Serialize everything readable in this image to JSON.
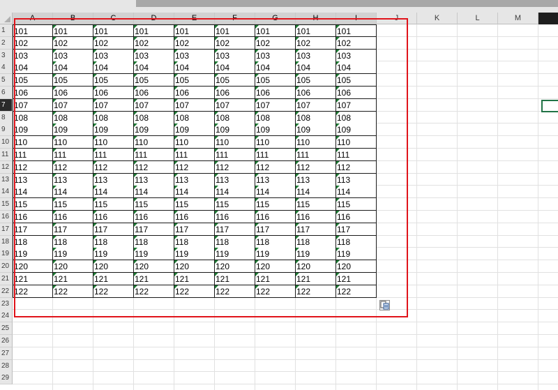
{
  "columns": [
    "A",
    "B",
    "C",
    "D",
    "E",
    "F",
    "G",
    "H",
    "I",
    "J",
    "K",
    "L",
    "M"
  ],
  "row_numbers": [
    "1",
    "2",
    "3",
    "4",
    "5",
    "6",
    "7",
    "8",
    "9",
    "10",
    "11",
    "12",
    "13",
    "14",
    "15",
    "16",
    "17",
    "18",
    "19",
    "20",
    "21",
    "22",
    "23",
    "24",
    "25",
    "26",
    "27",
    "28",
    "29"
  ],
  "active_row": "7",
  "cell_values": [
    "101",
    "102",
    "103",
    "104",
    "105",
    "106",
    "107",
    "108",
    "109",
    "110",
    "111",
    "112",
    "113",
    "114",
    "115",
    "116",
    "117",
    "118",
    "119",
    "120",
    "121",
    "122"
  ],
  "filled_column_count": 9,
  "highlight_color": "#e0131a",
  "accent_color": "#217346",
  "error_indicator_color": "#1e7b34",
  "paste_options_icon": "paste-options-icon"
}
